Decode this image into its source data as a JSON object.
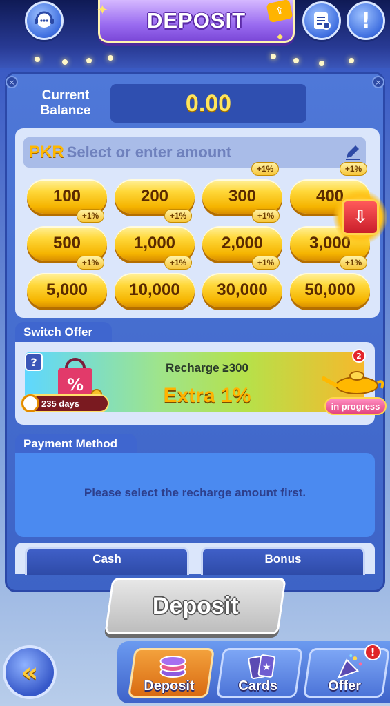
{
  "header": {
    "title": "DEPOSIT",
    "support_icon": "headset-chat-icon",
    "records_icon": "history-list-icon",
    "notice_icon": "exclamation-icon"
  },
  "balance": {
    "label": "Current Balance",
    "value": "0.00"
  },
  "amount_input": {
    "currency": "PKR",
    "placeholder": "Select or enter amount",
    "edit_icon": "pencil-icon"
  },
  "amounts": [
    {
      "label": "100",
      "bonus": ""
    },
    {
      "label": "200",
      "bonus": ""
    },
    {
      "label": "300",
      "bonus": "+1%"
    },
    {
      "label": "400",
      "bonus": "+1%"
    },
    {
      "label": "500",
      "bonus": "+1%"
    },
    {
      "label": "1,000",
      "bonus": "+1%"
    },
    {
      "label": "2,000",
      "bonus": "+1%"
    },
    {
      "label": "3,000",
      "bonus": ""
    },
    {
      "label": "5,000",
      "bonus": "+1%"
    },
    {
      "label": "10,000",
      "bonus": "+1%"
    },
    {
      "label": "30,000",
      "bonus": "+1%"
    },
    {
      "label": "50,000",
      "bonus": "+1%"
    }
  ],
  "switch_offer": {
    "tab_label": "Switch Offer",
    "help_label": "?",
    "days": "235 days",
    "line1": "Recharge ≥300",
    "line2": "Extra  1%",
    "count_badge": "2",
    "status": "in progress"
  },
  "payment": {
    "tab_label": "Payment Method",
    "message": "Please select the recharge amount first."
  },
  "wallet": {
    "cash_label": "Cash",
    "bonus_label": "Bonus"
  },
  "deposit_button": "Deposit",
  "bottom_nav": {
    "back_glyph": "«",
    "items": [
      {
        "label": "Deposit",
        "icon": "chips-icon"
      },
      {
        "label": "Cards",
        "icon": "cards-icon"
      },
      {
        "label": "Offer",
        "icon": "party-popper-icon"
      }
    ],
    "offer_alert": "!"
  },
  "colors": {
    "accent_gold": "#ffd83a",
    "panel_blue": "#3d63c6",
    "balance_yellow": "#ffe55c"
  }
}
